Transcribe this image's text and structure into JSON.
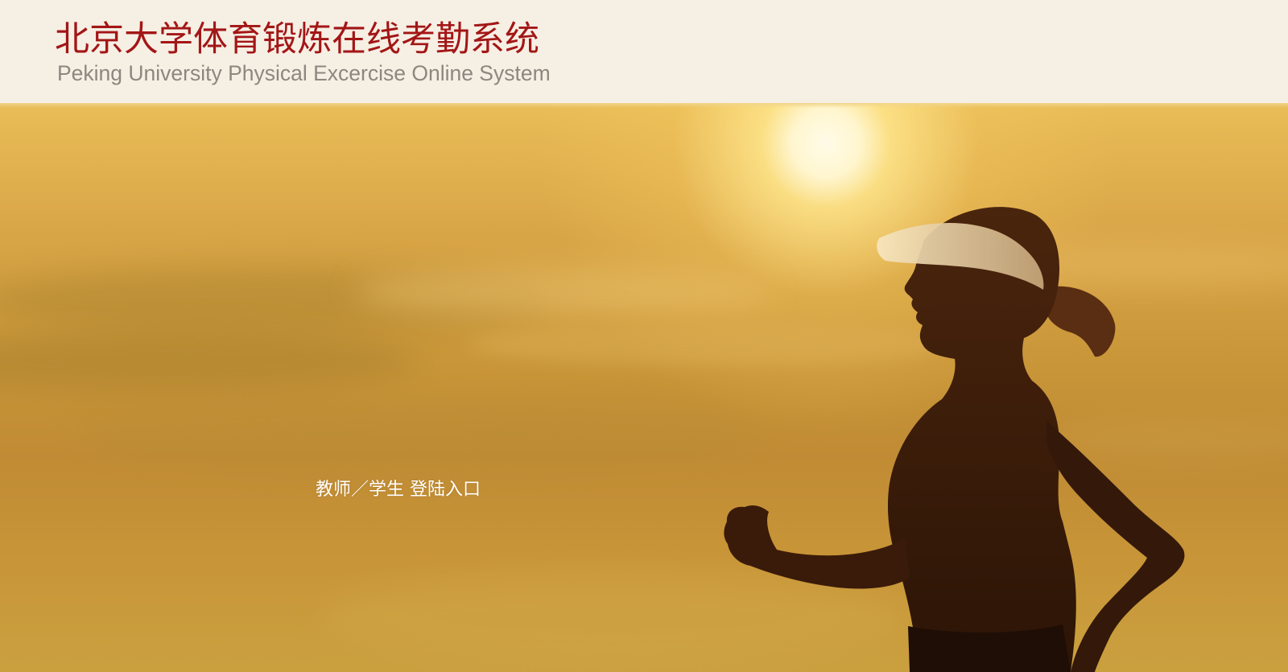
{
  "header": {
    "title_cn": "北京大学体育锻炼在线考勤系统",
    "title_en": "Peking University Physical Excercise Online System"
  },
  "hero": {
    "login_link": "教师／学生 登陆入口"
  },
  "colors": {
    "brand_red": "#a31616",
    "header_bg": "#f6efe4",
    "subtitle_gray": "#8d8780",
    "sky_gold": "#d9a647"
  },
  "icons": {
    "hero_image": "runner-silhouette-sunset"
  }
}
